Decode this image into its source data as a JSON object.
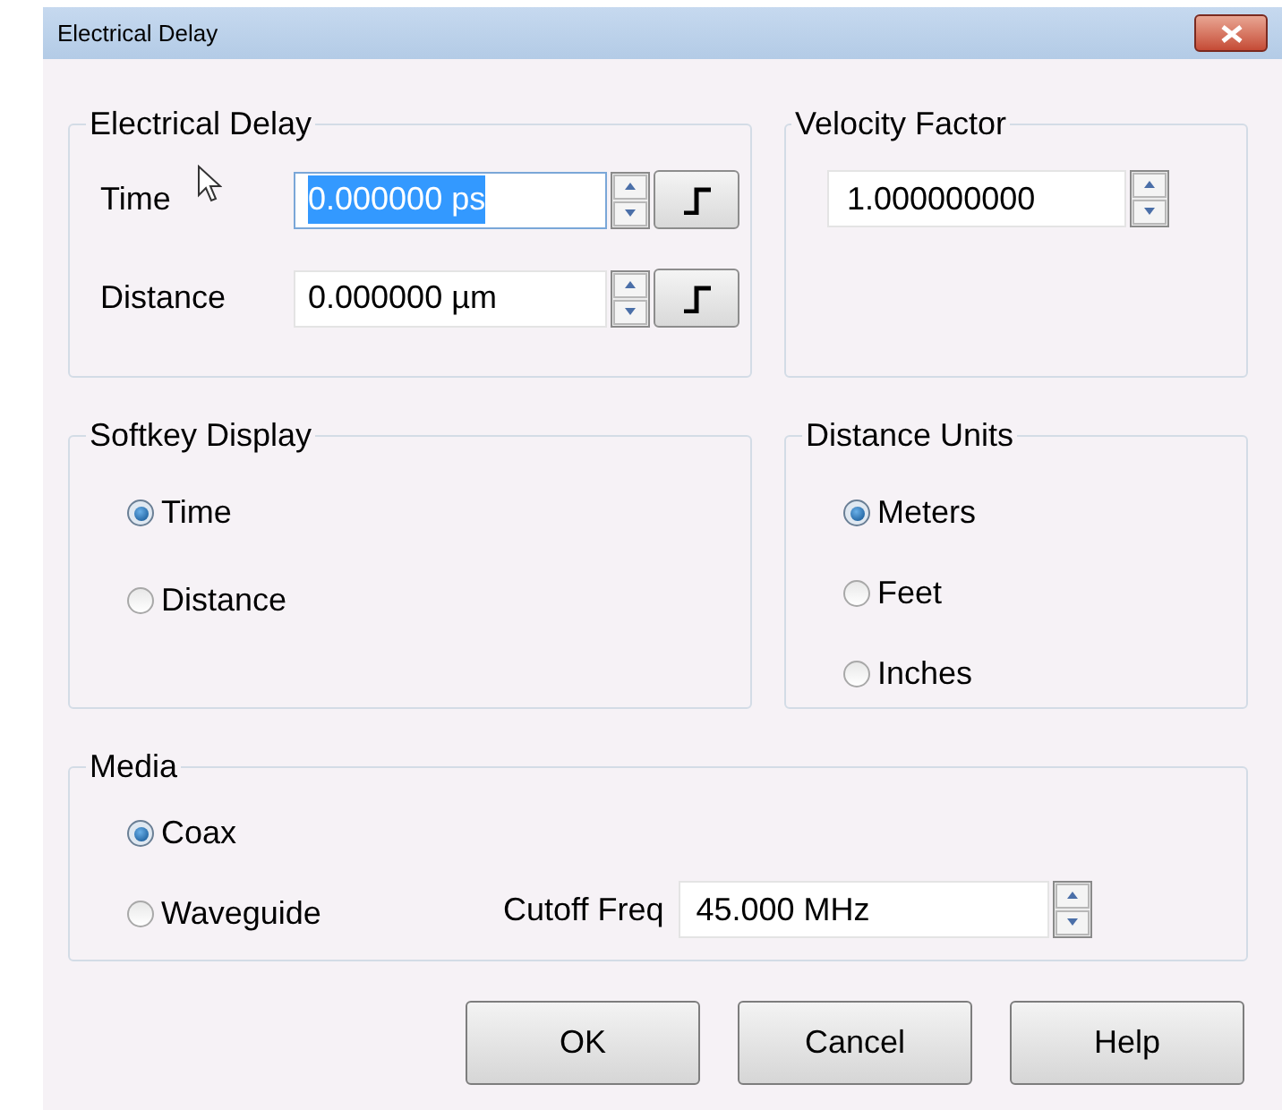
{
  "window": {
    "title": "Electrical Delay"
  },
  "electrical_delay": {
    "title": "Electrical Delay",
    "fields": [
      {
        "label": "Time",
        "value": "0.000000 ps",
        "selected": true
      },
      {
        "label": "Distance",
        "value": "0.000000 µm",
        "selected": false
      }
    ]
  },
  "velocity_factor": {
    "title": "Velocity Factor",
    "value": "1.000000000"
  },
  "softkey_display": {
    "title": "Softkey Display",
    "options": [
      {
        "label": "Time",
        "selected": true
      },
      {
        "label": "Distance",
        "selected": false
      }
    ]
  },
  "distance_units": {
    "title": "Distance Units",
    "options": [
      {
        "label": "Meters",
        "selected": true
      },
      {
        "label": "Feet",
        "selected": false
      },
      {
        "label": "Inches",
        "selected": false
      }
    ]
  },
  "media": {
    "title": "Media",
    "options": [
      {
        "label": "Coax",
        "selected": true
      },
      {
        "label": "Waveguide",
        "selected": false
      }
    ],
    "cutoff": {
      "label": "Cutoff Freq",
      "value": "45.000 MHz"
    }
  },
  "buttons": [
    "OK",
    "Cancel",
    "Help"
  ]
}
